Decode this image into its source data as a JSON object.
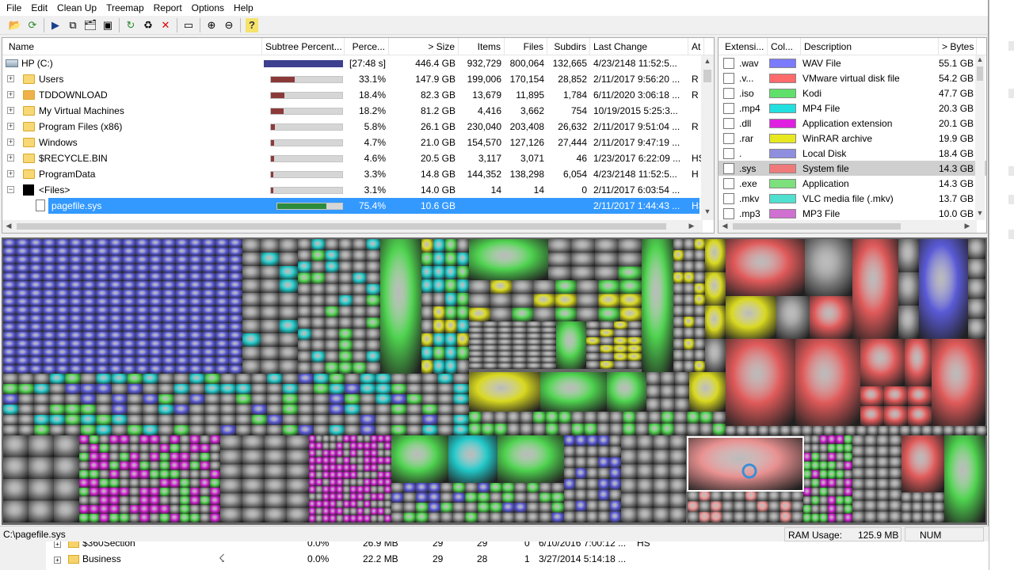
{
  "menu": [
    "File",
    "Edit",
    "Clean Up",
    "Treemap",
    "Report",
    "Options",
    "Help"
  ],
  "toolbar": [
    {
      "name": "open-icon",
      "glyph": "📂"
    },
    {
      "name": "refresh-all-icon",
      "glyph": "⟳"
    },
    {
      "name": "play-icon",
      "glyph": "▶"
    },
    {
      "name": "copy-path-icon",
      "glyph": "⧉"
    },
    {
      "name": "explorer-icon",
      "glyph": "🗂"
    },
    {
      "name": "command-prompt-icon",
      "glyph": "▣"
    },
    {
      "name": "refresh-selected-icon",
      "glyph": "↻"
    },
    {
      "name": "recycle-icon",
      "glyph": "♻"
    },
    {
      "name": "delete-icon",
      "glyph": "✕"
    },
    {
      "name": "new-folder-icon",
      "glyph": "▭"
    },
    {
      "name": "zoom-in-icon",
      "glyph": "⊕"
    },
    {
      "name": "zoom-out-icon",
      "glyph": "⊖"
    },
    {
      "name": "help-icon",
      "glyph": "?"
    }
  ],
  "tree": {
    "columns": [
      "Name",
      "Subtree Percent...",
      "Perce...",
      "> Size",
      "Items",
      "Files",
      "Subdirs",
      "Last Change",
      "At"
    ],
    "rows": [
      {
        "name": "HP (C:)",
        "icon": "drive",
        "level": 0,
        "expander": "",
        "bar": 1.0,
        "root": true,
        "pct": "[27:48 s]",
        "size": "446.4 GB",
        "items": "932,729",
        "files": "800,064",
        "subdirs": "132,665",
        "change": "4/23/2148  11:52:5...",
        "attr": ""
      },
      {
        "name": "Users",
        "icon": "folder",
        "level": 1,
        "expander": "+",
        "bar": 0.331,
        "pct": "33.1%",
        "size": "147.9 GB",
        "items": "199,006",
        "files": "170,154",
        "subdirs": "28,852",
        "change": "2/11/2017  9:56:20 ...",
        "attr": "R"
      },
      {
        "name": "TDDOWNLOAD",
        "icon": "folder-special",
        "level": 1,
        "expander": "+",
        "bar": 0.184,
        "pct": "18.4%",
        "size": "82.3 GB",
        "items": "13,679",
        "files": "11,895",
        "subdirs": "1,784",
        "change": "6/11/2020  3:06:18 ...",
        "attr": "R"
      },
      {
        "name": "My Virtual Machines",
        "icon": "folder",
        "level": 1,
        "expander": "+",
        "bar": 0.182,
        "pct": "18.2%",
        "size": "81.2 GB",
        "items": "4,416",
        "files": "3,662",
        "subdirs": "754",
        "change": "10/19/2015  5:25:3...",
        "attr": ""
      },
      {
        "name": "Program Files (x86)",
        "icon": "folder",
        "level": 1,
        "expander": "+",
        "bar": 0.058,
        "pct": "5.8%",
        "size": "26.1 GB",
        "items": "230,040",
        "files": "203,408",
        "subdirs": "26,632",
        "change": "2/11/2017  9:51:04 ...",
        "attr": "R"
      },
      {
        "name": "Windows",
        "icon": "folder",
        "level": 1,
        "expander": "+",
        "bar": 0.047,
        "pct": "4.7%",
        "size": "21.0 GB",
        "items": "154,570",
        "files": "127,126",
        "subdirs": "27,444",
        "change": "2/11/2017  9:47:19 ...",
        "attr": ""
      },
      {
        "name": "$RECYCLE.BIN",
        "icon": "folder",
        "level": 1,
        "expander": "+",
        "bar": 0.046,
        "pct": "4.6%",
        "size": "20.5 GB",
        "items": "3,117",
        "files": "3,071",
        "subdirs": "46",
        "change": "1/23/2017  6:22:09 ...",
        "attr": "HS"
      },
      {
        "name": "ProgramData",
        "icon": "folder",
        "level": 1,
        "expander": "+",
        "bar": 0.033,
        "pct": "3.3%",
        "size": "14.8 GB",
        "items": "144,352",
        "files": "138,298",
        "subdirs": "6,054",
        "change": "4/23/2148  11:52:5...",
        "attr": "H"
      },
      {
        "name": "<Files>",
        "icon": "black",
        "level": 1,
        "expander": "−",
        "bar": 0.031,
        "pct": "3.1%",
        "size": "14.0 GB",
        "items": "14",
        "files": "14",
        "subdirs": "0",
        "change": "2/11/2017  6:03:54 ...",
        "attr": ""
      },
      {
        "name": "pagefile.sys",
        "icon": "file",
        "level": 2,
        "expander": "",
        "bar": 0.754,
        "green": true,
        "selected": true,
        "pct": "75.4%",
        "size": "10.6 GB",
        "items": "",
        "files": "",
        "subdirs": "",
        "change": "2/11/2017  1:44:43 ...",
        "attr": "HS"
      }
    ]
  },
  "extensions": {
    "columns": [
      "Extensi...",
      "Col...",
      "Description",
      "> Bytes"
    ],
    "rows": [
      {
        "ext": ".wav",
        "color": "#7b7bff",
        "desc": "WAV File",
        "bytes": "55.1 GB"
      },
      {
        "ext": ".v...",
        "color": "#ff6b6b",
        "desc": "VMware virtual disk file",
        "bytes": "54.2 GB"
      },
      {
        "ext": ".iso",
        "color": "#5fe06a",
        "desc": "Kodi",
        "bytes": "47.7 GB"
      },
      {
        "ext": ".mp4",
        "color": "#22e0e0",
        "desc": "MP4 File",
        "bytes": "20.3 GB"
      },
      {
        "ext": ".dll",
        "color": "#e020e0",
        "desc": "Application extension",
        "bytes": "20.1 GB"
      },
      {
        "ext": ".rar",
        "color": "#e8e820",
        "desc": "WinRAR archive",
        "bytes": "19.9 GB"
      },
      {
        "ext": ".",
        "color": "#8f8fe0",
        "desc": "Local Disk",
        "bytes": "18.4 GB"
      },
      {
        "ext": ".sys",
        "color": "#f07a7a",
        "desc": "System file",
        "bytes": "14.3 GB",
        "highlight": true
      },
      {
        "ext": ".exe",
        "color": "#7ce07c",
        "desc": "Application",
        "bytes": "14.3 GB"
      },
      {
        "ext": ".mkv",
        "color": "#50e0d0",
        "desc": "VLC media file (.mkv)",
        "bytes": "13.7 GB"
      },
      {
        "ext": ".mp3",
        "color": "#d070d0",
        "desc": "MP3 File",
        "bytes": "10.0 GB"
      }
    ]
  },
  "status": {
    "path": "C:\\pagefile.sys",
    "ram_label": "RAM Usage:",
    "ram_value": "125.9 MB",
    "num": "NUM"
  },
  "behind_window": {
    "rows": [
      {
        "name": "$360Section",
        "pct": "0.0%",
        "size": "26.9 MB",
        "items": "29",
        "files": "29",
        "subdirs": "0",
        "change": "6/10/2016  7:00:12 ...",
        "attr": "HS"
      },
      {
        "name": "Business",
        "pct": "0.0%",
        "size": "22.2 MB",
        "items": "29",
        "files": "28",
        "subdirs": "1",
        "change": "3/27/2014  5:14:18 ...",
        "attr": ""
      }
    ]
  },
  "colors": {
    "selection": "#3399ff",
    "bar_fill": "#8b3a3a",
    "root_bar": "#3d3f8f",
    "selected_bar": "#2e8b3e"
  }
}
